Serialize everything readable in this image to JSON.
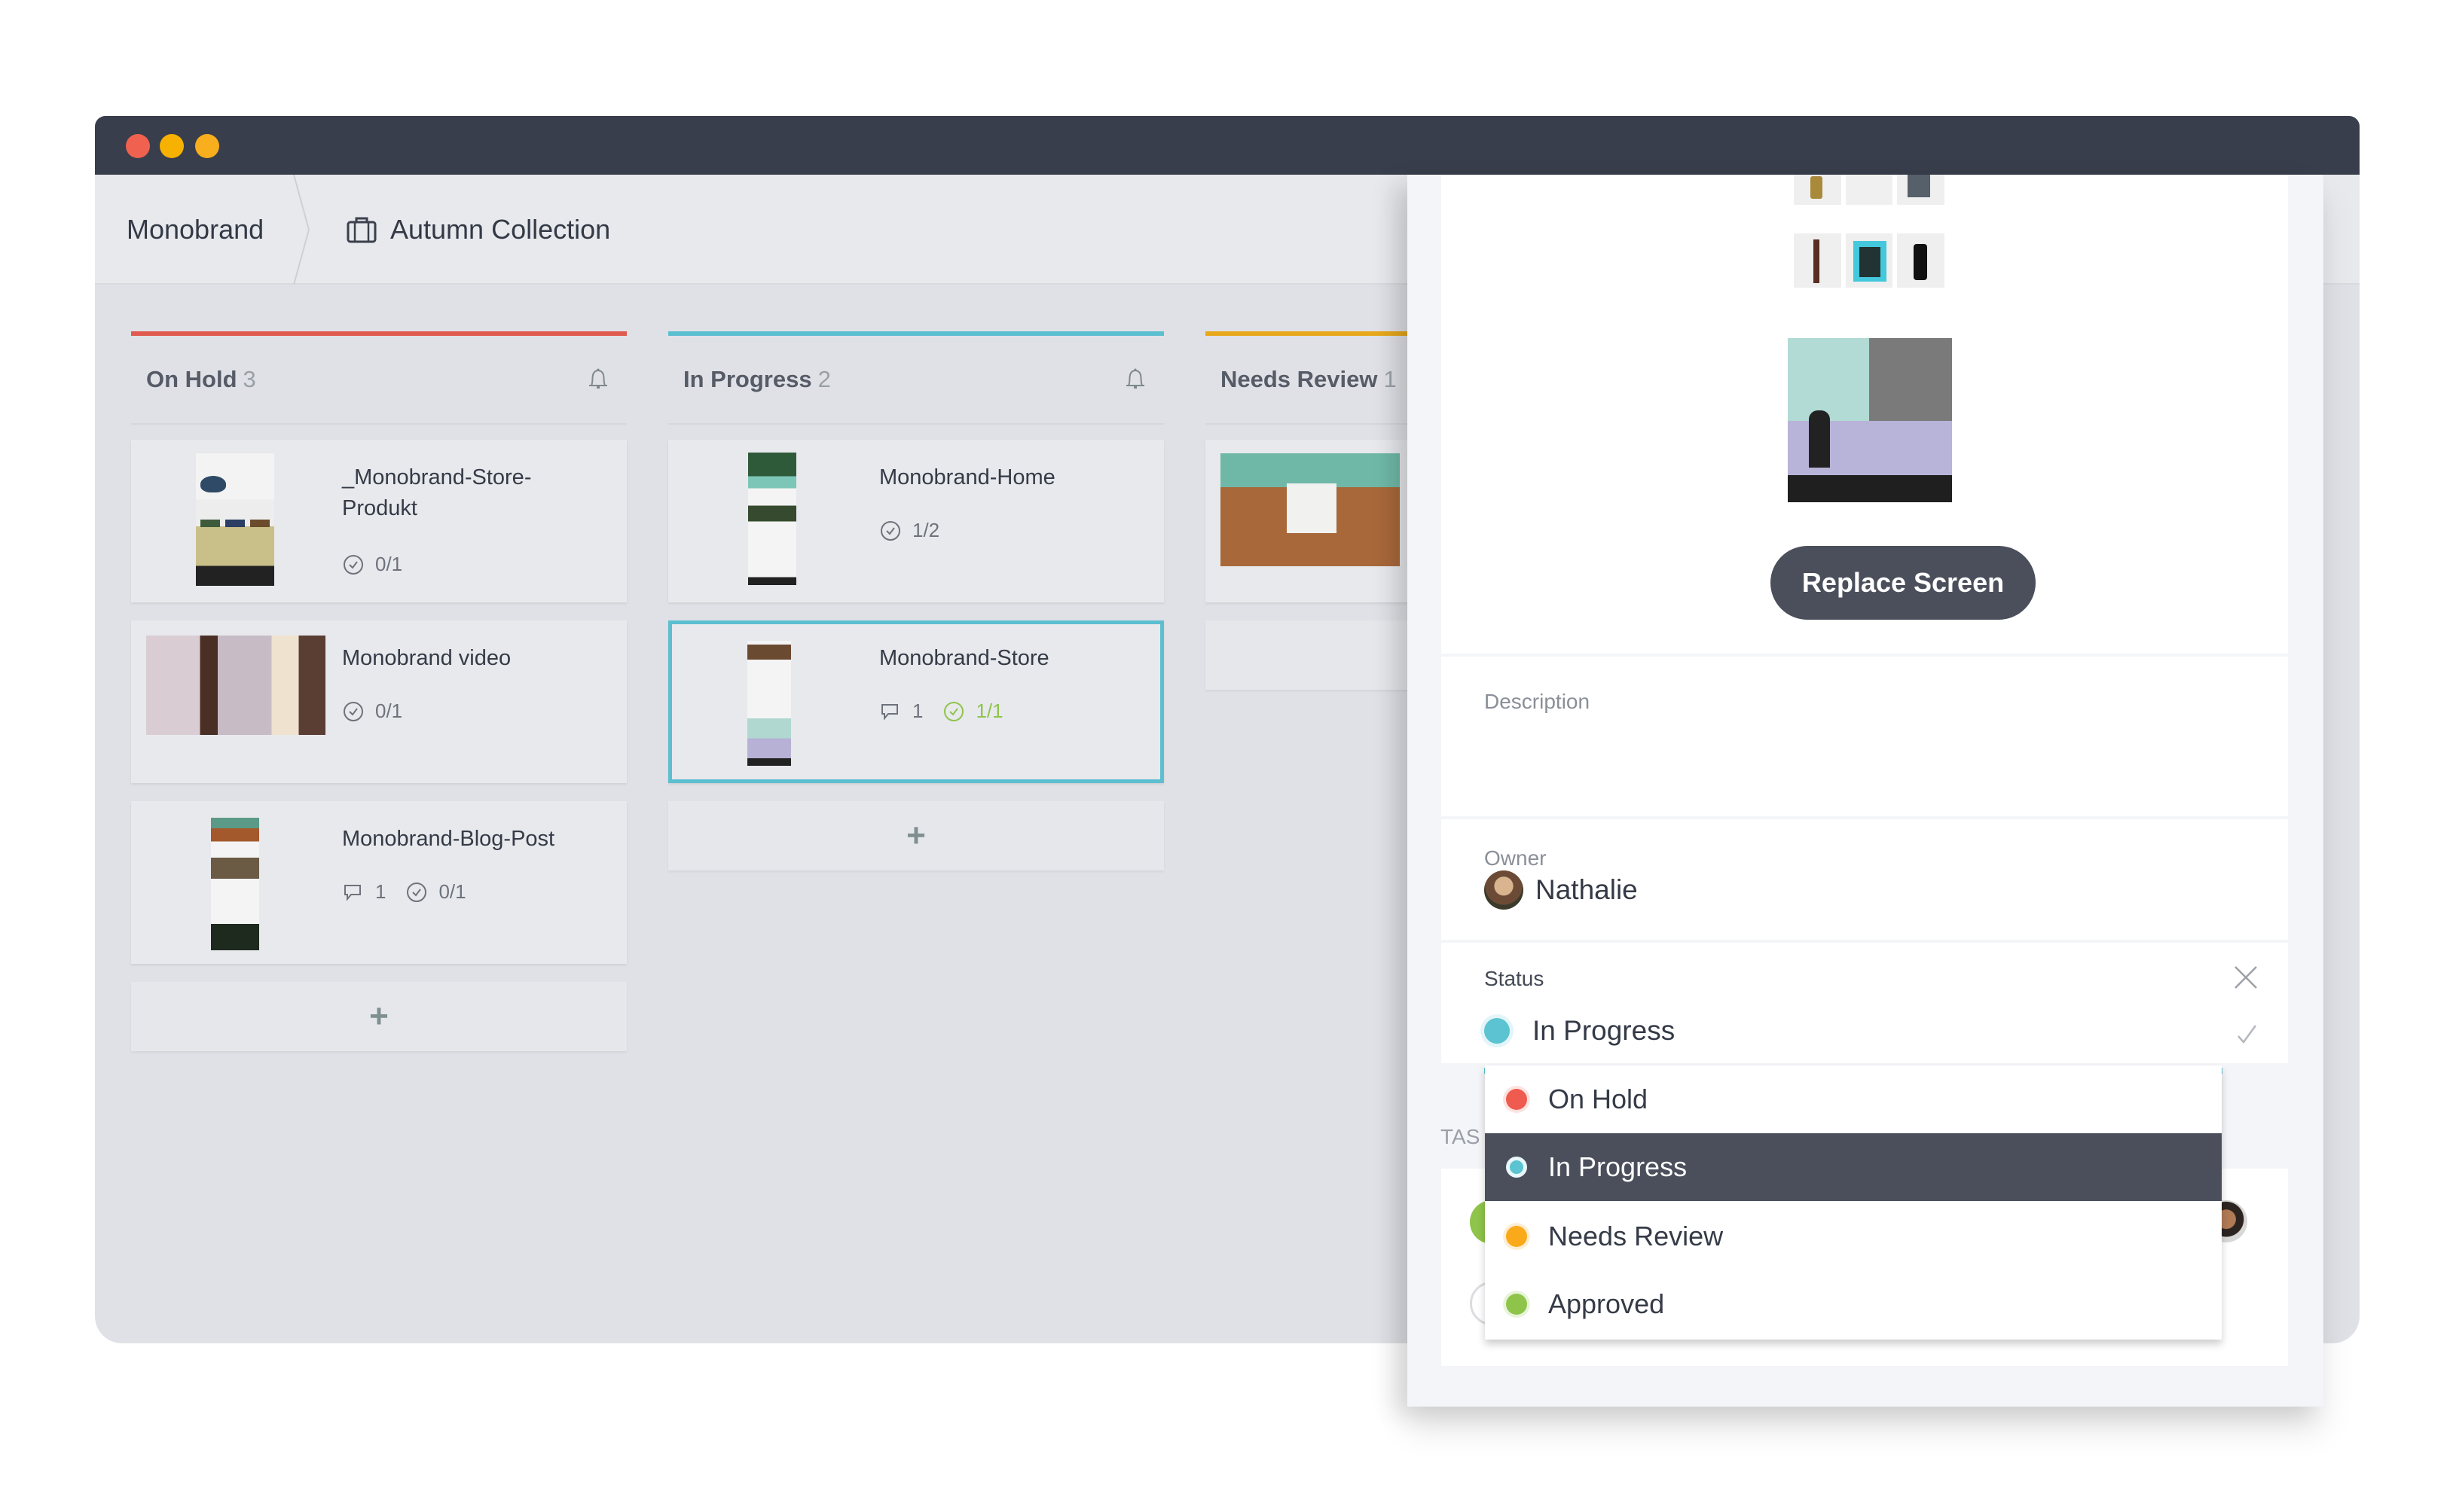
{
  "window": {
    "traffic_lights": [
      "close",
      "minimize",
      "zoom"
    ]
  },
  "breadcrumb": {
    "items": [
      {
        "label": "Monobrand",
        "icon": null
      },
      {
        "label": "Autumn Collection",
        "icon": "briefcase-icon"
      }
    ]
  },
  "board": {
    "columns": [
      {
        "title": "On Hold",
        "count": "3",
        "color": "#e05a4e",
        "cards": [
          {
            "title": "_Monobrand-Store-Produkt",
            "comments": null,
            "tasks": "0/1",
            "tasks_done": false
          },
          {
            "title": "Monobrand video",
            "comments": null,
            "tasks": "0/1",
            "tasks_done": false
          },
          {
            "title": "Monobrand-Blog-Post",
            "comments": "1",
            "tasks": "0/1",
            "tasks_done": false
          }
        ],
        "add_label": "+"
      },
      {
        "title": "In Progress",
        "count": "2",
        "color": "#5bbfd0",
        "cards": [
          {
            "title": "Monobrand-Home",
            "comments": null,
            "tasks": "1/2",
            "tasks_done": false
          },
          {
            "title": "Monobrand-Store",
            "comments": "1",
            "tasks": "1/1",
            "tasks_done": true,
            "selected": true
          }
        ],
        "add_label": "+"
      },
      {
        "title": "Needs Review",
        "count": "1",
        "color": "#e8a81c",
        "cards": [
          {
            "title": "",
            "comments": null,
            "tasks": null
          }
        ]
      }
    ]
  },
  "panel": {
    "replace_button": "Replace Screen",
    "description_label": "Description",
    "description_value": "",
    "owner_label": "Owner",
    "owner_name": "Nathalie",
    "status_label": "Status",
    "status_value": "In Progress",
    "status_color": "#5bc3d1",
    "tasks_label": "TAS"
  },
  "status_dropdown": {
    "options": [
      {
        "label": "On Hold",
        "color": "#ef5b4f",
        "selected": false
      },
      {
        "label": "In Progress",
        "color": "#5bc3d1",
        "selected": true
      },
      {
        "label": "Needs Review",
        "color": "#f9a91a",
        "selected": false
      },
      {
        "label": "Approved",
        "color": "#8fc44a",
        "selected": false
      }
    ]
  }
}
